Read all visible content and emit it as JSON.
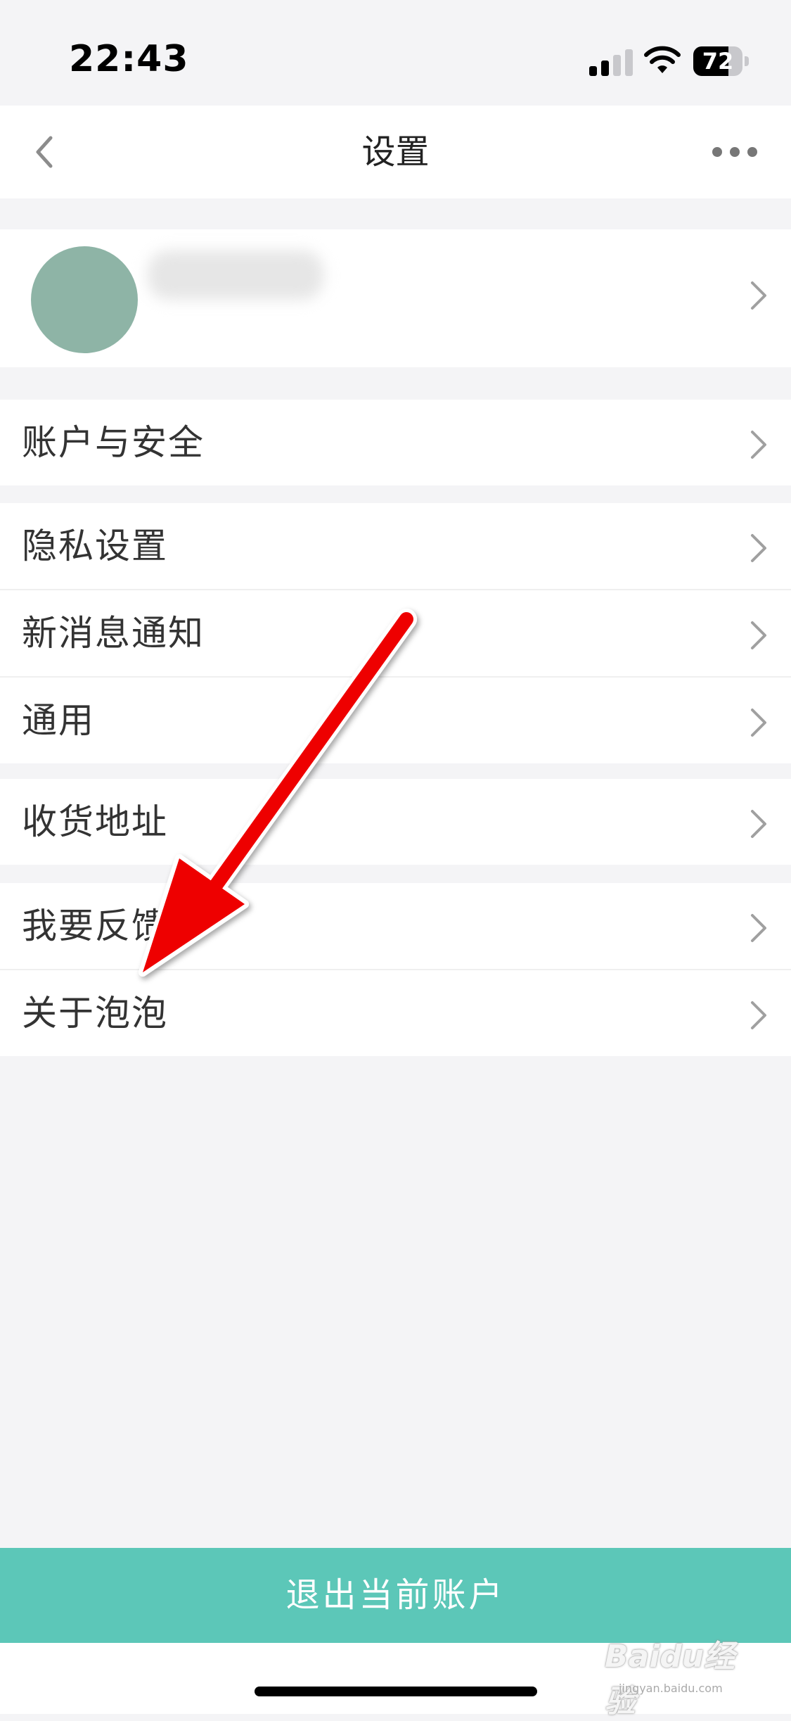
{
  "status_bar": {
    "time": "22:43",
    "battery": "72",
    "battery_level": 0.72
  },
  "nav": {
    "title": "设置"
  },
  "menu": {
    "group1": [
      {
        "label": "账户与安全"
      }
    ],
    "group2": [
      {
        "label": "隐私设置"
      },
      {
        "label": "新消息通知"
      },
      {
        "label": "通用"
      }
    ],
    "group3": [
      {
        "label": "收货地址"
      }
    ],
    "group4": [
      {
        "label": "我要反馈"
      },
      {
        "label": "关于泡泡"
      }
    ]
  },
  "logout": {
    "label": "退出当前账户"
  },
  "watermark": {
    "text": "Baidu经验",
    "url": "jingyan.baidu.com"
  },
  "colors": {
    "accent": "#5cc7b8",
    "arrow": "#ee0000",
    "avatar": "#8eb4a6"
  }
}
